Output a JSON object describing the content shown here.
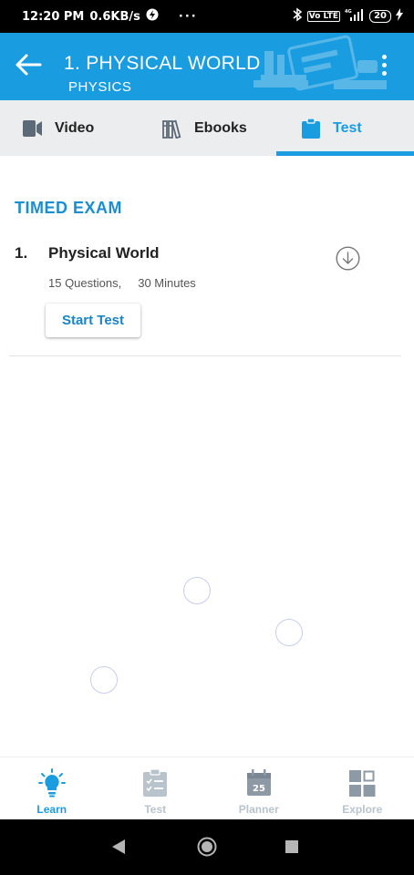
{
  "status_bar": {
    "time": "12:20 PM",
    "speed": "0.6KB/s",
    "more": "···",
    "volte": "Vo LTE",
    "network": "4G",
    "battery": "20"
  },
  "header": {
    "title": "1. PHYSICAL WORLD",
    "subtitle": "PHYSICS"
  },
  "tabs": [
    {
      "label": "Video",
      "icon": "video-camera-icon",
      "active": false
    },
    {
      "label": "Ebooks",
      "icon": "books-icon",
      "active": false
    },
    {
      "label": "Test",
      "icon": "clipboard-icon",
      "active": true
    }
  ],
  "section": {
    "title": "TIMED EXAM",
    "items": [
      {
        "number": "1.",
        "title": "Physical World",
        "questions": "15 Questions,",
        "duration": "30 Minutes",
        "action_label": "Start Test"
      }
    ]
  },
  "bottom_nav": [
    {
      "label": "Learn",
      "icon": "lightbulb-icon",
      "active": true
    },
    {
      "label": "Test",
      "icon": "checklist-icon",
      "active": false
    },
    {
      "label": "Planner",
      "icon": "calendar-icon",
      "active": false,
      "badge": "25"
    },
    {
      "label": "Explore",
      "icon": "grid-icon",
      "active": false
    }
  ],
  "colors": {
    "primary": "#1a9ce0",
    "tab_bg": "#ecedee",
    "inactive_nav": "#b9c3cc"
  }
}
